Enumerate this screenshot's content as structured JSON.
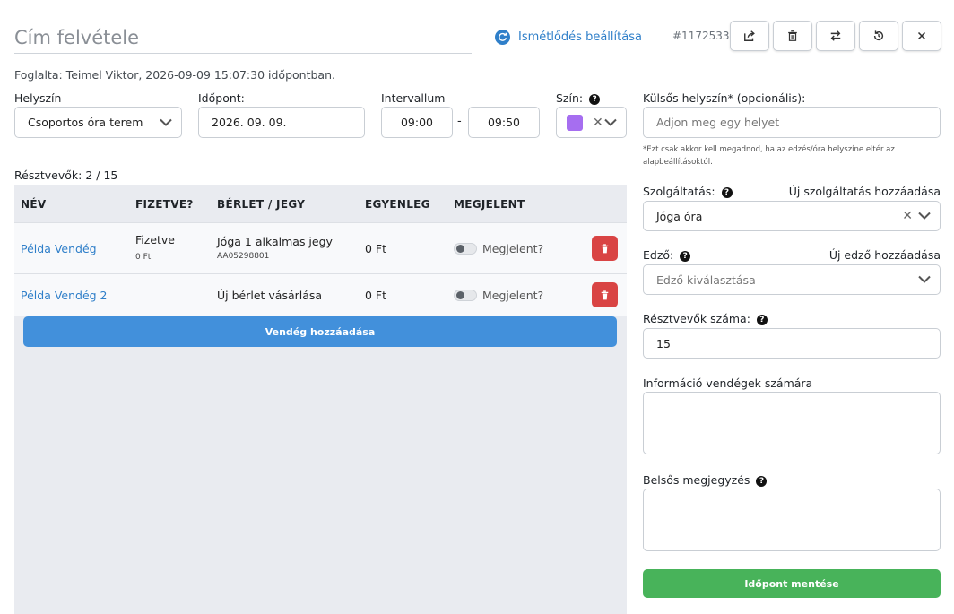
{
  "header": {
    "title_placeholder": "Cím felvétele",
    "recurrence_label": "Ismétlődés beállítása",
    "event_id": "#1172533"
  },
  "booked_by": "Foglalta: Teimel Viktor, 2026-09-09 15:07:30 időpontban.",
  "form": {
    "location_label": "Helyszín",
    "location_value": "Csoportos óra terem",
    "date_label": "Időpont:",
    "date_value": "2026. 09. 09.",
    "interval_label": "Intervallum",
    "interval_start": "09:00",
    "interval_sep": "-",
    "interval_end": "09:50",
    "color_label": "Szín:",
    "color_value": "#a66ef0",
    "external_location_label": "Külsős helyszín* (opcionális):",
    "external_location_placeholder": "Adjon meg egy helyet",
    "external_location_hint": "*Ezt csak akkor kell megadnod, ha az edzés/óra helyszíne eltér az alapbeállításoktól.",
    "service_label": "Szolgáltatás:",
    "service_add_link": "Új szolgáltatás hozzáadása",
    "service_value": "Jóga óra",
    "trainer_label": "Edző:",
    "trainer_add_link": "Új edző hozzáadása",
    "trainer_placeholder": "Edző kiválasztása",
    "participants_label": "Résztvevők száma:",
    "participants_value": "15",
    "guest_info_label": "Információ vendégek számára",
    "internal_note_label": "Belsős megjegyzés",
    "save_label": "Időpont mentése"
  },
  "participants": {
    "count_label": "Résztvevők: 2 / 15",
    "columns": [
      "NÉV",
      "FIZETVE?",
      "BÉRLET / JEGY",
      "EGYENLEG",
      "MEGJELENT"
    ],
    "rows": [
      {
        "name": "Példa Vendég",
        "paid": "Fizetve",
        "paid_amount": "0 Ft",
        "pass": "Jóga 1 alkalmas jegy",
        "pass_code": "AA05298801",
        "balance": "0 Ft",
        "attended_label": "Megjelent?"
      },
      {
        "name": "Példa Vendég 2",
        "paid": "",
        "paid_amount": "",
        "pass": "Új bérlet vásárlása",
        "pass_code": "",
        "balance": "0 Ft",
        "attended_label": "Megjelent?"
      }
    ],
    "add_guest_label": "Vendég hozzáadása"
  },
  "colors": {
    "link_blue": "#2f7fc9",
    "primary_button": "#4290db",
    "danger": "#d94444",
    "success": "#48b35a"
  }
}
